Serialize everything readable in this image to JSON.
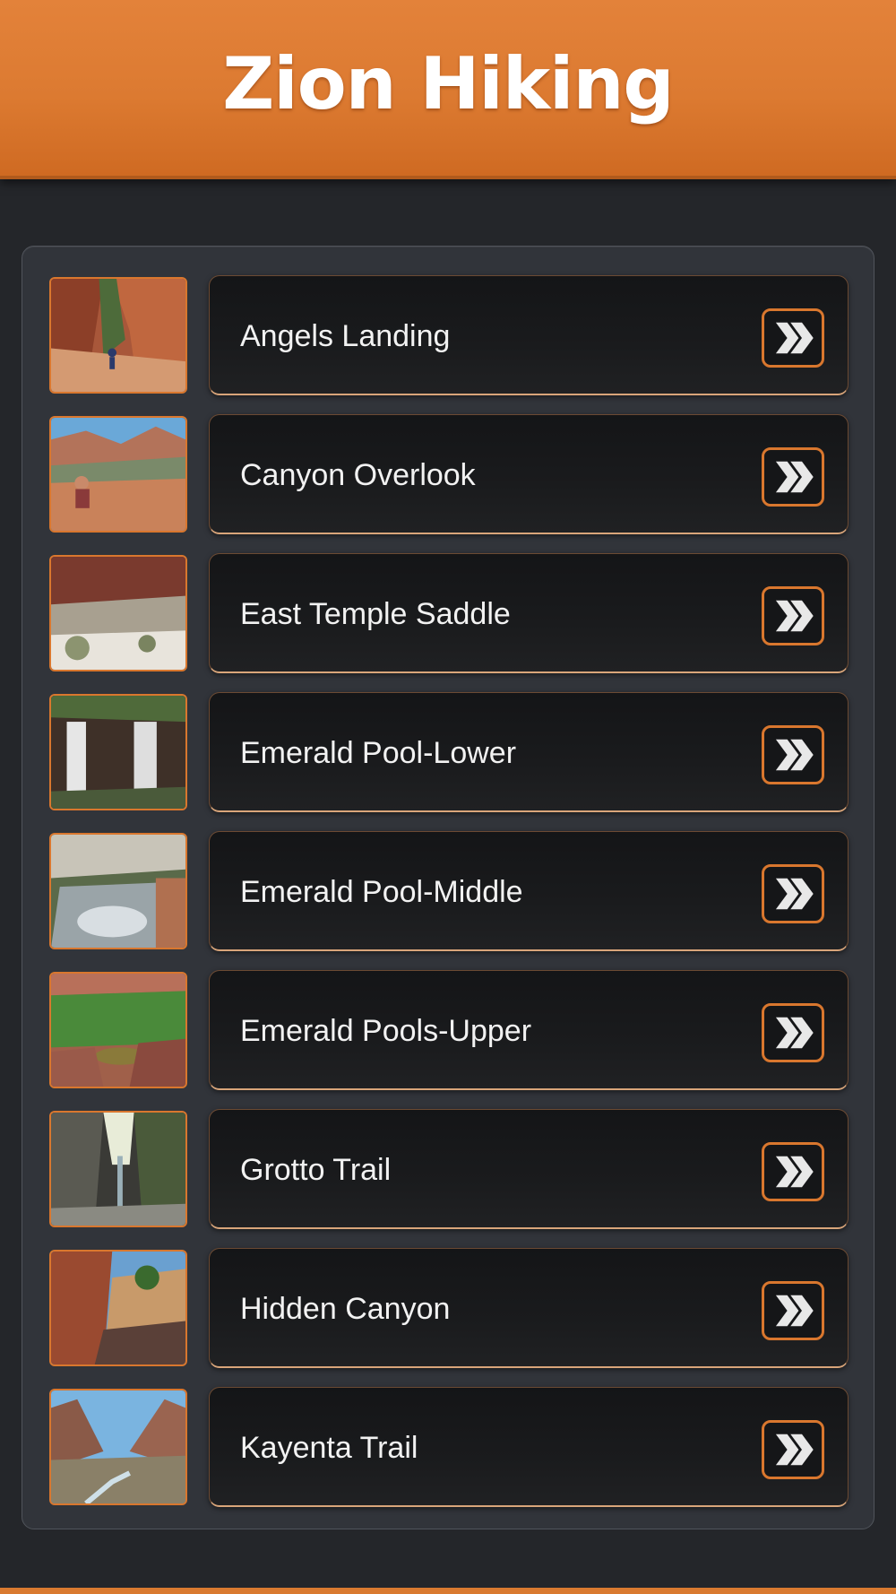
{
  "header": {
    "title": "Zion Hiking"
  },
  "colors": {
    "accent": "#d9772e",
    "header_orange": "#dc7a31",
    "background": "#24262a",
    "panel": "#31343a",
    "button": "#1a1b1d",
    "text": "#f2f2f2"
  },
  "trails": [
    {
      "label": "Angels Landing",
      "icon": "double-chevron-right-icon"
    },
    {
      "label": "Canyon Overlook",
      "icon": "double-chevron-right-icon"
    },
    {
      "label": "East Temple Saddle",
      "icon": "double-chevron-right-icon"
    },
    {
      "label": "Emerald Pool-Lower",
      "icon": "double-chevron-right-icon"
    },
    {
      "label": "Emerald Pool-Middle",
      "icon": "double-chevron-right-icon"
    },
    {
      "label": "Emerald Pools-Upper",
      "icon": "double-chevron-right-icon"
    },
    {
      "label": "Grotto Trail",
      "icon": "double-chevron-right-icon"
    },
    {
      "label": "Hidden Canyon",
      "icon": "double-chevron-right-icon"
    },
    {
      "label": "Kayenta Trail",
      "icon": "double-chevron-right-icon"
    }
  ]
}
